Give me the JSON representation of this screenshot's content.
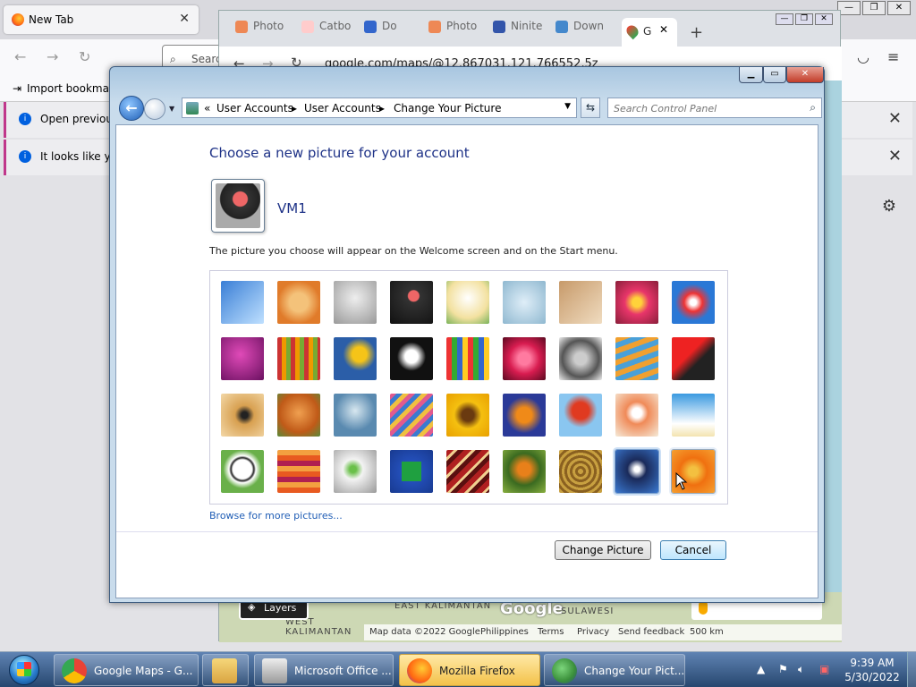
{
  "firefox": {
    "tab_title": "New Tab",
    "search_placeholder": "Search",
    "bookmark_import": "Import bookmarks...",
    "notification1": "Open previous tabs?",
    "notification2": "It looks like you haven't started Firefox in a while."
  },
  "chrome": {
    "tabs": [
      "Photo",
      "Catbo",
      "Do",
      "Photo",
      "Ninite",
      "Down",
      "G"
    ],
    "url": "google.com/maps/@12.867031,121.766552,5z",
    "map": {
      "layers_label": "Layers",
      "labels": [
        "EAST KALIMANTAN",
        "WEST KALIMANTAN",
        "SULAWESI"
      ],
      "logo": "Google",
      "attribution": [
        "Map data ©2022 Google",
        "Philippines",
        "Terms",
        "Privacy",
        "Send feedback",
        "500 km"
      ]
    }
  },
  "window": {
    "breadcrumb": [
      "User Accounts",
      "User Accounts",
      "Change Your Picture"
    ],
    "search_placeholder": "Search Control Panel",
    "heading": "Choose a new picture for your account",
    "username": "VM1",
    "description": "The picture you choose will appear on the Welcome screen and on the Start menu.",
    "browse_link": "Browse for more pictures...",
    "change_button": "Change Picture",
    "cancel_button": "Cancel",
    "pictures": [
      "roller-coaster",
      "starfish",
      "robot-toy",
      "turntable",
      "lucky-cat",
      "gyroscope",
      "kitten",
      "flower-pink",
      "ferris-wheel",
      "ball-purple",
      "fabric-stripes",
      "leaf-blue",
      "dog",
      "crayons",
      "star-lantern",
      "jacks",
      "stairs",
      "origami-crane",
      "guitar",
      "pomeranian",
      "tin-robot",
      "scarves",
      "sunflower",
      "fish",
      "hot-air-balloon",
      "doll",
      "sailboat",
      "soccer-ball",
      "fabric-orange",
      "marbles",
      "window-green",
      "rug",
      "butterfly",
      "nest",
      "lighthouse",
      "daisy-orange"
    ],
    "selected_picture": "lighthouse"
  },
  "taskbar": {
    "items": [
      "Google Maps - G...",
      "",
      "Microsoft Office ...",
      "Mozilla Firefox",
      "Change Your Pict..."
    ],
    "time": "9:39 AM",
    "date": "5/30/2022"
  },
  "colors": {
    "heading": "#1e3287",
    "link": "#1f5db5",
    "taskbar_top": "#5f83b3",
    "taskbar_bottom": "#27476f"
  }
}
